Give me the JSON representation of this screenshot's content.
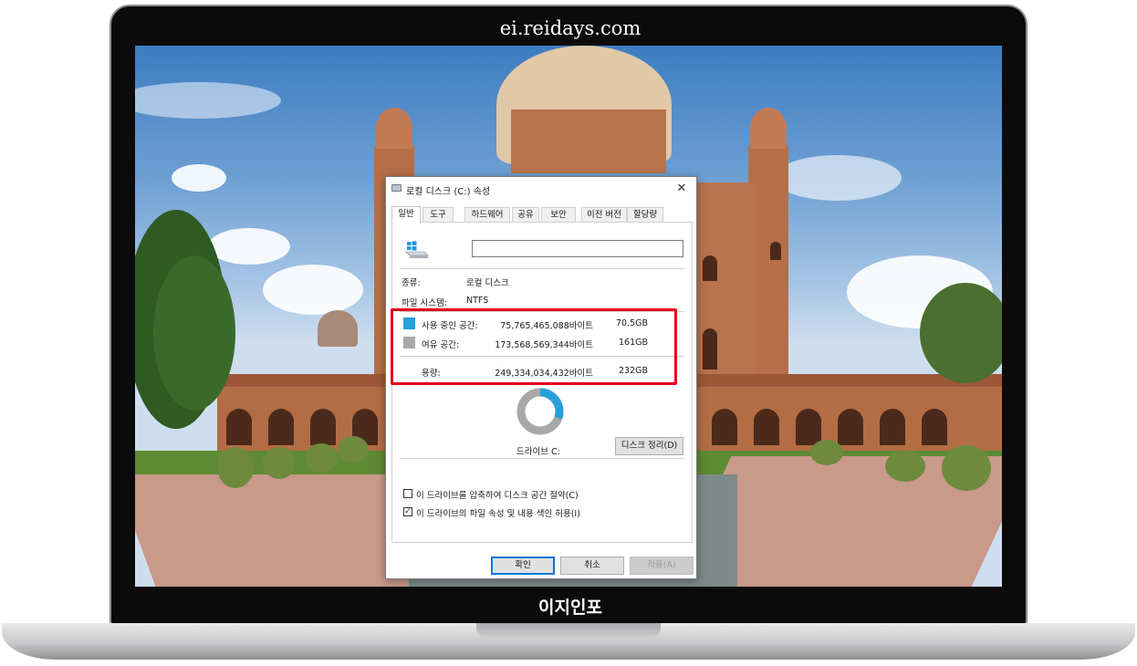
{
  "frame": {
    "site_label": "ei.reidays.com",
    "bottom_label": "이지인포"
  },
  "dialog": {
    "title": "로컬 디스크 (C:) 속성",
    "close_glyph": "✕",
    "tabs": [
      "일반",
      "도구",
      "하드웨어",
      "공유",
      "보안",
      "이전 버전",
      "할당량"
    ],
    "active_tab": "일반",
    "drive_name_value": "",
    "type_label": "종류:",
    "type_value": "로컬 디스크",
    "fs_label": "파일 시스템:",
    "fs_value": "NTFS",
    "used": {
      "label": "사용 중인 공간:",
      "bytes": "75,765,465,088바이트",
      "size": "70.5GB",
      "color": "#26a0da"
    },
    "free": {
      "label": "여유 공간:",
      "bytes": "173,568,569,344바이트",
      "size": "161GB",
      "color": "#a8a8a8"
    },
    "capacity": {
      "label": "용량:",
      "bytes": "249,334,034,432바이트",
      "size": "232GB"
    },
    "usage_fraction": 0.304,
    "drive_label": "드라이브 C:",
    "cleanup_button": "디스크 정리(D)",
    "compress_label": "이 드라이브를 압축하여 디스크 공간 절약(C)",
    "compress_checked": false,
    "index_label": "이 드라이브의 파일 속성 및 내용 색인 허용(I)",
    "index_checked": true,
    "ok_button": "확인",
    "cancel_button": "취소",
    "apply_button": "적용(A)"
  },
  "colors": {
    "highlight": "#e3001b",
    "used": "#26a0da",
    "free": "#a8a8a8"
  }
}
